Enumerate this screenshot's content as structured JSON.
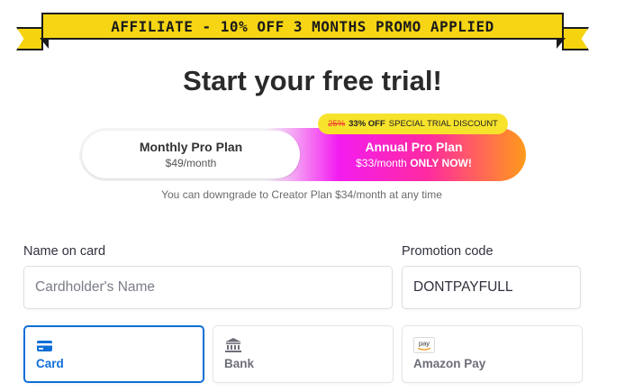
{
  "banner": {
    "text": "AFFILIATE - 10% OFF 3 MONTHS PROMO APPLIED"
  },
  "title": "Start your free trial!",
  "plans": {
    "monthly": {
      "name": "Monthly Pro Plan",
      "price": "$49/month"
    },
    "annual": {
      "name": "Annual Pro Plan",
      "price": "$33/month",
      "price_suffix": "ONLY NOW!"
    },
    "badge": {
      "old": "25%",
      "off": "33% OFF",
      "text": "SPECIAL TRIAL DISCOUNT"
    }
  },
  "downgrade_note": "You can downgrade to Creator Plan $34/month at any time",
  "form": {
    "name_label": "Name on card",
    "name_placeholder": "Cardholder's Name",
    "promo_label": "Promotion code",
    "promo_value": "DONTPAYFULL"
  },
  "payment_methods": [
    {
      "label": "Card",
      "icon": "credit-card-icon",
      "active": true
    },
    {
      "label": "Bank",
      "icon": "bank-icon",
      "active": false
    },
    {
      "label": "Amazon Pay",
      "icon": "amazon-pay-icon",
      "icon_text": "pay",
      "active": false
    }
  ],
  "colors": {
    "accent": "#0f6fd8",
    "banner": "#f6d514",
    "badge": "#f7e32c"
  }
}
